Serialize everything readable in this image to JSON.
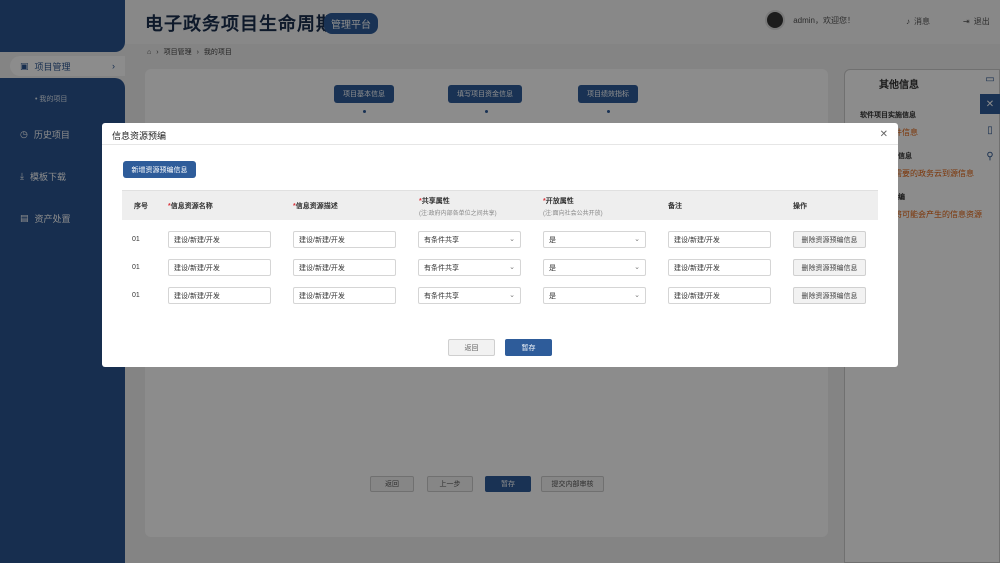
{
  "header": {
    "app_title": "电子政务项目生命周期",
    "app_badge": "管理平台",
    "user_greeting": "admin，欢迎您！",
    "messages_label": "消息",
    "logout_label": "退出"
  },
  "sidebar": {
    "items": [
      {
        "label": "项目管理",
        "active": true
      },
      {
        "label": "历史项目"
      },
      {
        "label": "模板下载"
      },
      {
        "label": "资产处置"
      }
    ],
    "sub_item": "我的项目"
  },
  "breadcrumb": [
    "项目管理",
    "我的项目"
  ],
  "steps": [
    "项目基本信息",
    "填写项目资金信息",
    "项目绩效指标"
  ],
  "bottom_buttons": {
    "back": "返回",
    "prev": "上一步",
    "save": "暂存",
    "submit": "提交内部审核"
  },
  "right_panel": {
    "title": "其他信息",
    "sections": [
      {
        "label": "软件项目实施信息",
        "value": "件信息"
      },
      {
        "label": "信息",
        "value": "需要的政务云到源信息"
      },
      {
        "label": "编",
        "value": "将可能会产生的信息资源"
      }
    ]
  },
  "modal": {
    "title": "信息资源预编",
    "add_button": "新增资源预编信息",
    "columns": [
      {
        "label": "序号"
      },
      {
        "label": "信息资源名称",
        "required": true
      },
      {
        "label": "信息资源描述",
        "required": true
      },
      {
        "label": "共享属性",
        "required": true,
        "note": "(注:政府内部各单位之间共享)"
      },
      {
        "label": "开放属性",
        "required": true,
        "note": "(注:面向社会公共开放)"
      },
      {
        "label": "备注"
      },
      {
        "label": "操作"
      }
    ],
    "rows": [
      {
        "index": "01",
        "name": "建设/新建/开发",
        "desc": "建设/新建/开发",
        "share": "有条件共享",
        "open": "是",
        "remark": "建设/新建/开发",
        "action": "删除资源预编信息"
      },
      {
        "index": "01",
        "name": "建设/新建/开发",
        "desc": "建设/新建/开发",
        "share": "有条件共享",
        "open": "是",
        "remark": "建设/新建/开发",
        "action": "删除资源预编信息"
      },
      {
        "index": "01",
        "name": "建设/新建/开发",
        "desc": "建设/新建/开发",
        "share": "有条件共享",
        "open": "是",
        "remark": "建设/新建/开发",
        "action": "删除资源预编信息"
      }
    ],
    "back_button": "返回",
    "save_button": "暂存"
  },
  "colors": {
    "primary": "#2e5c9a",
    "accent_orange": "#e2600c",
    "required_red": "#d9363e"
  }
}
